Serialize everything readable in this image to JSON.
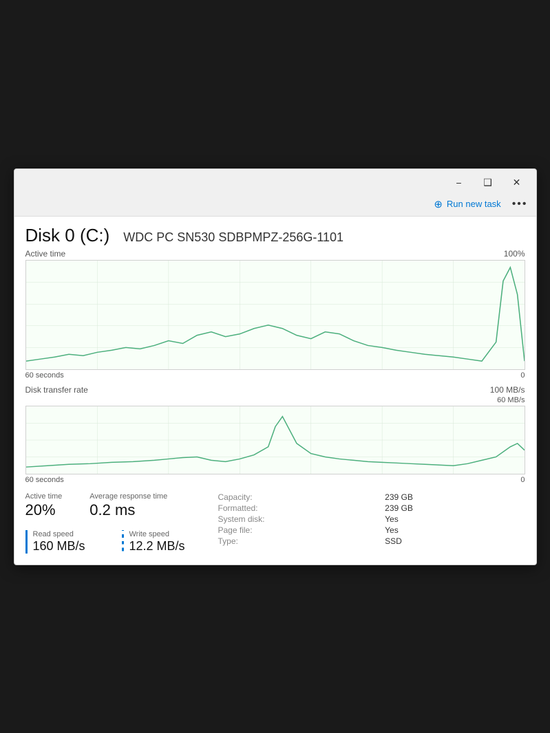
{
  "titlebar": {
    "minimize_label": "−",
    "restore_label": "❑",
    "close_label": "✕"
  },
  "toolbar": {
    "run_new_task_label": "Run new task",
    "more_label": "•••",
    "task_icon": "⊕"
  },
  "disk": {
    "title": "Disk 0 (C:)",
    "model": "WDC PC SN530 SDBPMPZ-256G-1101"
  },
  "active_time_chart": {
    "label": "Active time",
    "max_label": "100%",
    "time_label": "60 seconds",
    "zero_label": "0"
  },
  "transfer_chart": {
    "label": "Disk transfer rate",
    "time_label": "60 seconds",
    "label_100": "100 MB/s",
    "label_60": "60 MB/s",
    "zero_label": "0"
  },
  "stats": {
    "active_time_label": "Active time",
    "active_time_value": "20%",
    "avg_response_label": "Average response time",
    "avg_response_value": "0.2 ms",
    "read_speed_label": "Read speed",
    "read_speed_value": "160 MB/s",
    "write_speed_label": "Write speed",
    "write_speed_value": "12.2 MB/s"
  },
  "info": {
    "capacity_label": "Capacity:",
    "capacity_value": "239 GB",
    "formatted_label": "Formatted:",
    "formatted_value": "239 GB",
    "system_disk_label": "System disk:",
    "system_disk_value": "Yes",
    "page_file_label": "Page file:",
    "page_file_value": "Yes",
    "type_label": "Type:",
    "type_value": "SSD"
  }
}
